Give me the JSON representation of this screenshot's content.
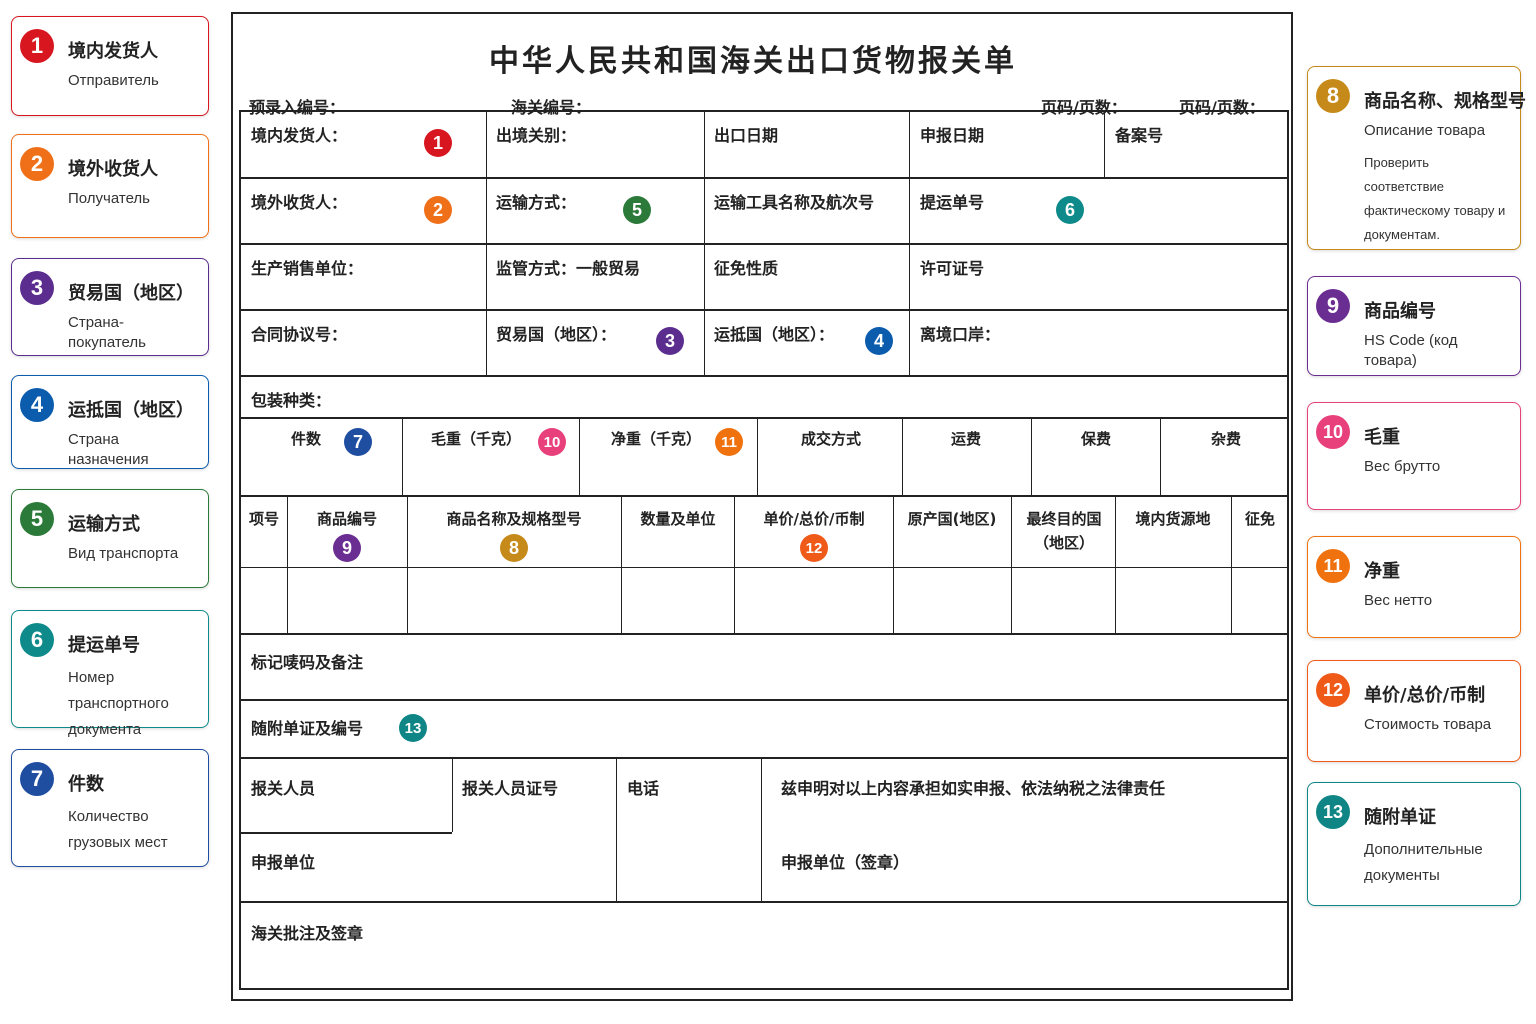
{
  "colors": {
    "c1": "#d7161f",
    "c2": "#f07019",
    "c3": "#5b2d8e",
    "c4": "#0b5cad",
    "c5": "#2c7a3a",
    "c6": "#0f8a8a",
    "c7": "#1f4ea0",
    "c8": "#c68a1a",
    "c9": "#6a2d91",
    "c10": "#e8407a",
    "c11": "#f0720f",
    "c12": "#f05a19",
    "c13": "#0f8585"
  },
  "legend_left": [
    {
      "num": "1",
      "zh": "境内发货人",
      "ru": "Отправитель"
    },
    {
      "num": "2",
      "zh": "境外收货人",
      "ru": "Получатель"
    },
    {
      "num": "3",
      "zh": "贸易国（地区）",
      "ru": "Страна-покупатель"
    },
    {
      "num": "4",
      "zh": "运抵国（地区）",
      "ru": "Страна назначения"
    },
    {
      "num": "5",
      "zh": "运输方式",
      "ru": "Вид транспорта"
    },
    {
      "num": "6",
      "zh": "提运单号",
      "ru": "Номер транспортного документа"
    },
    {
      "num": "7",
      "zh": "件数",
      "ru": "Количество грузовых мест"
    }
  ],
  "legend_right": [
    {
      "num": "8",
      "zh": "商品名称、规格型号",
      "ru": "Описание товара",
      "note": "Проверить соответствие фактическому товару и документам."
    },
    {
      "num": "9",
      "zh": "商品编号",
      "ru": "HS Code (код товара)"
    },
    {
      "num": "10",
      "zh": "毛重",
      "ru": "Вес брутто"
    },
    {
      "num": "11",
      "zh": "净重",
      "ru": "Вес нетто"
    },
    {
      "num": "12",
      "zh": "单价/总价/币制",
      "ru": "Стоимость товара"
    },
    {
      "num": "13",
      "zh": "随附单证",
      "ru": "Дополнительные документы"
    }
  ],
  "form": {
    "title": "中华人民共和国海关出口货物报关单",
    "pre_entry_no": "预录入编号：",
    "customs_no": "海关编号：",
    "page_a": "页码/页数：",
    "page_b": "页码/页数：",
    "exporter": "境内发货人：",
    "exit_customs": "出境关别：",
    "export_date": "出口日期",
    "declare_date": "申报日期",
    "record_no": "备案号",
    "consignee": "境外收货人：",
    "transport_mode": "运输方式：",
    "vessel": "运输工具名称及航次号",
    "bill_no": "提运单号",
    "producer": "生产销售单位：",
    "supervision": "监管方式：一般贸易",
    "exemption_nature": "征免性质",
    "license_no": "许可证号",
    "contract_no": "合同协议号：",
    "trade_country": "贸易国（地区）：",
    "dest_country": "运抵国（地区）：",
    "exit_port": "离境口岸：",
    "packaging": "包装种类：",
    "packages": "件数",
    "gross_weight": "毛重（千克）",
    "net_weight": "净重（千克）",
    "transaction_mode": "成交方式",
    "freight": "运费",
    "insurance": "保费",
    "misc_fee": "杂费",
    "item_no": "项号",
    "hs_code": "商品编号",
    "goods_name": "商品名称及规格型号",
    "quantity_unit": "数量及单位",
    "price": "单价/总价/币制",
    "origin": "原产国(地区)",
    "final_dest": "最终目的国（地区）",
    "domestic_source": "境内货源地",
    "exemption": "征免",
    "marks": "标记唛码及备注",
    "attached_docs": "随附单证及编号",
    "declarant": "报关人员",
    "declarant_id": "报关人员证号",
    "phone": "电话",
    "statement": "兹申明对以上内容承担如实申报、依法纳税之法律责任",
    "declaring_unit": "申报单位",
    "declaring_unit_seal": "申报单位（签章）",
    "customs_approval": "海关批注及签章"
  }
}
